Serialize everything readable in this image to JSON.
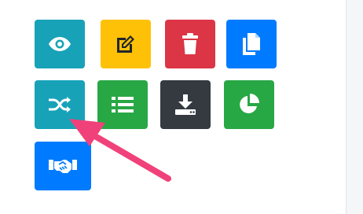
{
  "colors": {
    "info": "#17a2b8",
    "warning": "#ffc107",
    "danger": "#dc3545",
    "primary": "#007bff",
    "success": "#28a745",
    "dark": "#343a40",
    "arrow": "#f0417a"
  },
  "buttons": [
    {
      "id": "view",
      "icon": "eye-icon",
      "color": "info"
    },
    {
      "id": "edit",
      "icon": "edit-icon",
      "color": "warning"
    },
    {
      "id": "delete",
      "icon": "trash-icon",
      "color": "danger"
    },
    {
      "id": "copy",
      "icon": "copy-icon",
      "color": "primary"
    },
    {
      "id": "shuffle",
      "icon": "shuffle-icon",
      "color": "info"
    },
    {
      "id": "list",
      "icon": "list-icon",
      "color": "success"
    },
    {
      "id": "download",
      "icon": "download-icon",
      "color": "dark"
    },
    {
      "id": "chart",
      "icon": "pie-chart-icon",
      "color": "success"
    },
    {
      "id": "handshake",
      "icon": "handshake-icon",
      "color": "primary"
    }
  ],
  "annotation": {
    "icon": "pointer-arrow-icon",
    "target": "shuffle"
  }
}
